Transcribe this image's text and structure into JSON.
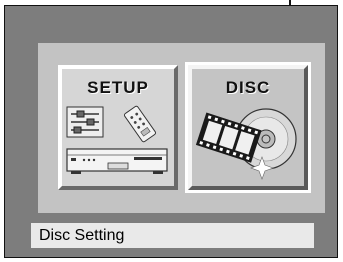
{
  "menu": {
    "items": [
      {
        "label": "SETUP",
        "icon": "setup-icon",
        "selected": false
      },
      {
        "label": "DISC",
        "icon": "disc-icon",
        "selected": true
      }
    ]
  },
  "status": {
    "text": "Disc Setting"
  },
  "colors": {
    "screen_background": "#7d7d7d",
    "panel_background": "#c3c3c3",
    "status_bar_background": "#e9e9e9"
  }
}
